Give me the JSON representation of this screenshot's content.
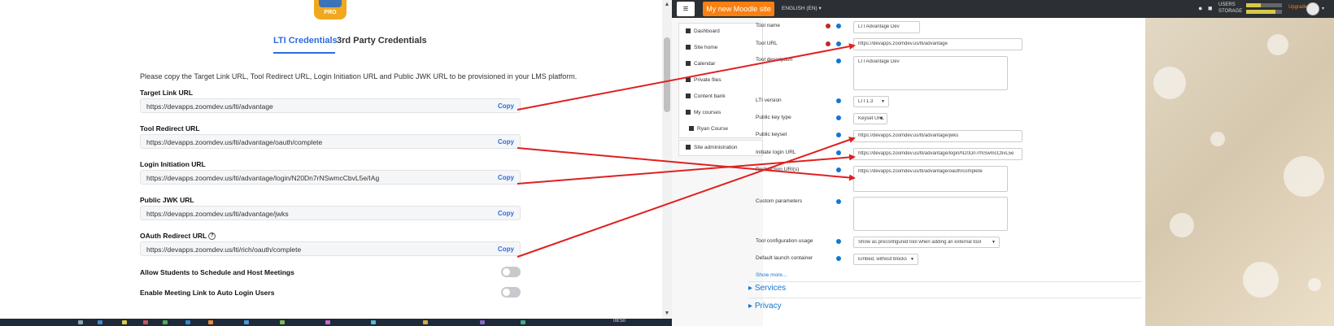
{
  "lti_app": {
    "logo_badge": "PRO",
    "tabs": [
      "LTI Credentials",
      "3rd Party Credentials"
    ],
    "intro": "Please copy the Target Link URL, Tool Redirect URL, Login Initiation URL and Public JWK URL to be provisioned in your LMS platform.",
    "copy_label": "Copy",
    "fields": [
      {
        "label": "Target Link URL",
        "value": "https://devapps.zoomdev.us/lti/advantage"
      },
      {
        "label": "Tool Redirect URL",
        "value": "https://devapps.zoomdev.us/lti/advantage/oauth/complete"
      },
      {
        "label": "Login Initiation URL",
        "value": "https://devapps.zoomdev.us/lti/advantage/login/N20Dn7rNSwmcCbvL5e/IAg"
      },
      {
        "label": "Public JWK URL",
        "value": "https://devapps.zoomdev.us/lti/advantage/jwks"
      },
      {
        "label": "OAuth Redirect URL",
        "value": "https://devapps.zoomdev.us/lti/rich/oauth/complete"
      }
    ],
    "toggles": [
      {
        "label": "Allow Students to Schedule and Host Meetings",
        "state": "off"
      },
      {
        "label": "Enable Meeting Link to Auto Login Users",
        "state": "off"
      }
    ],
    "taskbar_time": "08:50"
  },
  "moodle": {
    "site_button": "My new Moodle site",
    "language": "ENGLISH (EN)",
    "nav_users": "USERS",
    "nav_storage": "STORAGE",
    "nav_upgrade": "Upgrade",
    "sidebar": [
      "Dashboard",
      "Site home",
      "Calendar",
      "Private files",
      "Content bank",
      "My courses",
      "Ryan Course"
    ],
    "sidebar_admin": "Site administration",
    "form": {
      "tool_name_label": "Tool name",
      "tool_name_value": "LTI Advantage Dev",
      "tool_url_label": "Tool URL",
      "tool_url_value": "https://devapps.zoomdev.us/lti/advantage",
      "tool_description_label": "Tool description",
      "tool_description_value": "LTI Advantage Dev",
      "lti_version_label": "LTI version",
      "lti_version_value": "LTI 1.3",
      "public_key_type_label": "Public key type",
      "public_key_type_value": "Keyset URL",
      "public_keyset_label": "Public keyset",
      "public_keyset_value": "https://devapps.zoomdev.us/lti/advantage/jwks",
      "initiate_login_label": "Initiate login URL",
      "initiate_login_value": "https://devapps.zoomdev.us/lti/advantage/login/N20Dn7rNSwmcCbvL5e",
      "redirection_uris_label": "Redirection URI(s)",
      "redirection_uris_value": "https://devapps.zoomdev.us/lti/advantage/oauth/complete",
      "custom_params_label": "Custom parameters",
      "tool_config_usage_label": "Tool configuration usage",
      "tool_config_usage_value": "Show as preconfigured tool when adding an external tool",
      "default_launch_label": "Default launch container",
      "default_launch_value": "Embed, without blocks",
      "show_more": "Show more...",
      "sections": [
        "Services",
        "Privacy"
      ]
    }
  },
  "colors": {
    "arrow": "#e02020",
    "lti_accent": "#2d6cdf",
    "moodle_orange": "#f98012",
    "moodle_link": "#1177d1"
  }
}
